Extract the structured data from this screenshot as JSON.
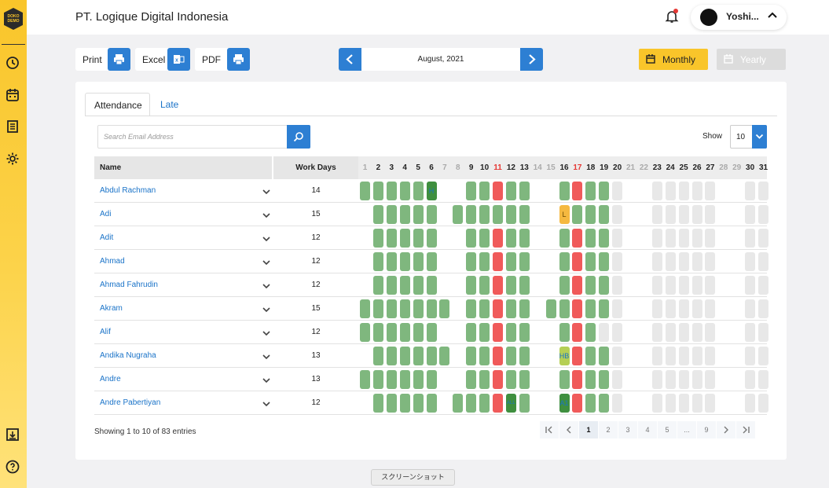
{
  "sidebar": {
    "logo_text": "DOKO DEMO",
    "icons": [
      "clock-icon",
      "calendar-icon",
      "list-icon",
      "settings-icon",
      "download-icon",
      "help-icon"
    ]
  },
  "header": {
    "company": "PT. Logique Digital Indonesia",
    "user_name": "Yoshi..."
  },
  "toolbar": {
    "print_label": "Print",
    "excel_label": "Excel",
    "pdf_label": "PDF",
    "month": "August, 2021",
    "monthly_label": "Monthly",
    "yearly_label": "Yearly"
  },
  "tabs": [
    "Attendance",
    "Late"
  ],
  "search": {
    "placeholder": "Search Email Address"
  },
  "show": {
    "label": "Show",
    "value": "10"
  },
  "table": {
    "name_header": "Name",
    "work_days_header": "Work Days",
    "days": [
      "1",
      "2",
      "3",
      "4",
      "5",
      "6",
      "7",
      "8",
      "9",
      "10",
      "11",
      "12",
      "13",
      "14",
      "15",
      "16",
      "17",
      "18",
      "19",
      "20",
      "21",
      "22",
      "23",
      "24",
      "25",
      "26",
      "27",
      "28",
      "29",
      "30",
      "31"
    ],
    "day_states": [
      "weekend",
      "",
      "",
      "",
      "",
      "",
      "weekend",
      "weekend",
      "",
      "",
      "holiday",
      "",
      "",
      "weekend",
      "weekend",
      "",
      "holiday",
      "",
      "",
      "",
      "weekend",
      "weekend",
      "",
      "",
      "",
      "",
      "",
      "weekend",
      "weekend",
      "",
      ""
    ],
    "legend_colors": {
      "present": "#7fb77e",
      "absent": "#f05a5a",
      "late": "#f5b940",
      "upcoming": "#e8e8e8",
      "mixed": "#b5cf55"
    },
    "rows": [
      {
        "name": "Abdul Rachman",
        "work_days": "14",
        "cells": [
          "G",
          "G",
          "G",
          "G",
          "G",
          "D",
          "",
          "",
          "G",
          "G",
          "R",
          "G",
          "G",
          "",
          "",
          "G",
          "R",
          "G",
          "G",
          "U",
          "",
          "",
          "U",
          "U",
          "U",
          "U",
          "U",
          "",
          "",
          "U",
          "U"
        ],
        "labels": {
          "6": "H"
        }
      },
      {
        "name": "Adi",
        "work_days": "15",
        "cells": [
          "",
          "G",
          "G",
          "G",
          "G",
          "G",
          "",
          "G",
          "G",
          "G",
          "G",
          "G",
          "G",
          "",
          "",
          "O",
          "G",
          "G",
          "G",
          "U",
          "",
          "",
          "U",
          "U",
          "U",
          "U",
          "U",
          "",
          "",
          "U",
          "U"
        ],
        "labels": {
          "16": "L"
        }
      },
      {
        "name": "Adit",
        "work_days": "12",
        "cells": [
          "",
          "G",
          "G",
          "G",
          "G",
          "G",
          "",
          "",
          "G",
          "G",
          "R",
          "G",
          "G",
          "",
          "",
          "G",
          "R",
          "G",
          "G",
          "U",
          "",
          "",
          "U",
          "U",
          "U",
          "U",
          "U",
          "",
          "",
          "U",
          "U"
        ],
        "labels": {}
      },
      {
        "name": "Ahmad",
        "work_days": "12",
        "cells": [
          "",
          "G",
          "G",
          "G",
          "G",
          "G",
          "",
          "",
          "G",
          "G",
          "R",
          "G",
          "G",
          "",
          "",
          "G",
          "R",
          "G",
          "G",
          "U",
          "",
          "",
          "U",
          "U",
          "U",
          "U",
          "U",
          "",
          "",
          "U",
          "U"
        ],
        "labels": {}
      },
      {
        "name": "Ahmad Fahrudin",
        "work_days": "12",
        "cells": [
          "",
          "G",
          "G",
          "G",
          "G",
          "G",
          "",
          "",
          "G",
          "G",
          "R",
          "G",
          "G",
          "",
          "",
          "G",
          "R",
          "G",
          "G",
          "U",
          "",
          "",
          "U",
          "U",
          "U",
          "U",
          "U",
          "",
          "",
          "U",
          "U"
        ],
        "labels": {}
      },
      {
        "name": "Akram",
        "work_days": "15",
        "cells": [
          "G",
          "G",
          "G",
          "G",
          "G",
          "G",
          "G",
          "",
          "G",
          "G",
          "R",
          "G",
          "G",
          "",
          "G",
          "G",
          "R",
          "G",
          "G",
          "U",
          "",
          "",
          "U",
          "U",
          "U",
          "U",
          "U",
          "",
          "",
          "U",
          "U"
        ],
        "labels": {}
      },
      {
        "name": "Alif",
        "work_days": "12",
        "cells": [
          "G",
          "G",
          "G",
          "G",
          "G",
          "G",
          "",
          "",
          "G",
          "G",
          "R",
          "G",
          "G",
          "",
          "",
          "G",
          "R",
          "G",
          "U",
          "U",
          "",
          "",
          "U",
          "U",
          "U",
          "U",
          "U",
          "",
          "",
          "U",
          "U"
        ],
        "labels": {}
      },
      {
        "name": "Andika Nugraha",
        "work_days": "13",
        "cells": [
          "",
          "G",
          "G",
          "G",
          "G",
          "G",
          "G",
          "",
          "G",
          "G",
          "R",
          "G",
          "G",
          "",
          "",
          "Y",
          "R",
          "G",
          "G",
          "U",
          "",
          "",
          "U",
          "U",
          "U",
          "U",
          "U",
          "",
          "",
          "U",
          "U"
        ],
        "labels": {
          "16": "HB"
        }
      },
      {
        "name": "Andre",
        "work_days": "13",
        "cells": [
          "G",
          "G",
          "G",
          "G",
          "G",
          "G",
          "",
          "",
          "G",
          "G",
          "R",
          "G",
          "G",
          "",
          "",
          "G",
          "R",
          "G",
          "G",
          "U",
          "",
          "",
          "U",
          "U",
          "U",
          "U",
          "U",
          "",
          "",
          "U",
          "U"
        ],
        "labels": {}
      },
      {
        "name": "Andre Pabertiyan",
        "work_days": "12",
        "cells": [
          "",
          "G",
          "G",
          "G",
          "G",
          "G",
          "",
          "G",
          "G",
          "G",
          "R",
          "D",
          "G",
          "",
          "",
          "D",
          "R",
          "G",
          "G",
          "U",
          "",
          "",
          "U",
          "U",
          "U",
          "U",
          "U",
          "",
          "",
          "U",
          "U"
        ],
        "labels": {
          "12": "ALL",
          "16": "A1"
        }
      }
    ]
  },
  "footer": {
    "entries_text": "Showing 1 to 10 of 83 entries",
    "pages": [
      "1",
      "2",
      "3",
      "4",
      "5",
      "...",
      "9"
    ]
  },
  "screenshot_label": "スクリーンショット"
}
